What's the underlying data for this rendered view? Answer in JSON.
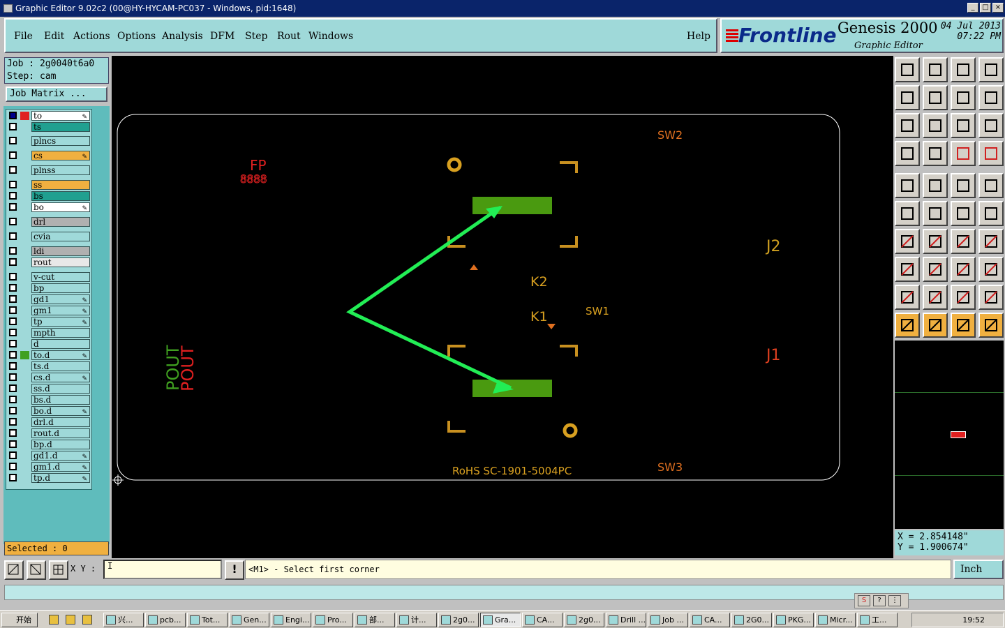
{
  "window": {
    "title": "Graphic Editor 9.02c2 (00@HY-HYCAM-PC037 - Windows, pid:1648)",
    "min": "_",
    "max": "□",
    "close": "×"
  },
  "menu": [
    "File",
    "Edit",
    "Actions",
    "Options",
    "Analysis",
    "DFM",
    "Step",
    "Rout",
    "Windows"
  ],
  "help": "Help",
  "brand": {
    "logo": "Frontline",
    "product": "Genesis 2000",
    "subtitle": "Graphic Editor",
    "date": "04 Jul 2013",
    "time": "07:22 PM"
  },
  "job": {
    "job_line": "Job : 2g0040t6a0",
    "step_line": "Step: cam",
    "matrix_button": "Job Matrix ..."
  },
  "layers": [
    {
      "name": "to",
      "color": "#ffffff",
      "pen": true
    },
    {
      "name": "ts",
      "color": "#20a090",
      "pen": false
    },
    {
      "name": "plncs",
      "color": "#9fd9d9",
      "pen": false
    },
    {
      "name": "cs",
      "color": "#f0b040",
      "pen": true
    },
    {
      "name": "plnss",
      "color": "#9fd9d9",
      "pen": false
    },
    {
      "name": "ss",
      "color": "#f0b040",
      "pen": false
    },
    {
      "name": "bs",
      "color": "#20a090",
      "pen": false
    },
    {
      "name": "bo",
      "color": "#ffffff",
      "pen": true
    },
    {
      "name": "drl",
      "color": "#b0b0b0",
      "pen": false
    },
    {
      "name": "cvia",
      "color": "#9fd9d9",
      "pen": false
    },
    {
      "name": "ldi",
      "color": "#b0b0b0",
      "pen": false
    },
    {
      "name": "rout",
      "color": "#e8e8e8",
      "pen": false
    },
    {
      "name": "v-cut",
      "color": "#9fd9d9",
      "pen": false
    },
    {
      "name": "bp",
      "color": "#9fd9d9",
      "pen": false
    },
    {
      "name": "gd1",
      "color": "#9fd9d9",
      "pen": true
    },
    {
      "name": "gm1",
      "color": "#9fd9d9",
      "pen": true
    },
    {
      "name": "tp",
      "color": "#9fd9d9",
      "pen": true
    },
    {
      "name": "mpth",
      "color": "#9fd9d9",
      "pen": false
    },
    {
      "name": "d",
      "color": "#9fd9d9",
      "pen": false
    },
    {
      "name": "to.d",
      "color": "#9fd9d9",
      "pen": true
    },
    {
      "name": "ts.d",
      "color": "#9fd9d9",
      "pen": false
    },
    {
      "name": "cs.d",
      "color": "#9fd9d9",
      "pen": true
    },
    {
      "name": "ss.d",
      "color": "#9fd9d9",
      "pen": false
    },
    {
      "name": "bs.d",
      "color": "#9fd9d9",
      "pen": false
    },
    {
      "name": "bo.d",
      "color": "#9fd9d9",
      "pen": true
    },
    {
      "name": "drl.d",
      "color": "#9fd9d9",
      "pen": false
    },
    {
      "name": "rout.d",
      "color": "#9fd9d9",
      "pen": false
    },
    {
      "name": "bp.d",
      "color": "#9fd9d9",
      "pen": false
    },
    {
      "name": "gd1.d",
      "color": "#9fd9d9",
      "pen": true
    },
    {
      "name": "gm1.d",
      "color": "#9fd9d9",
      "pen": true
    },
    {
      "name": "tp.d",
      "color": "#9fd9d9",
      "pen": true
    }
  ],
  "selected": "Selected : 0",
  "canvas_labels": {
    "fp": "FP",
    "fp_sub": "8888",
    "sw2": "SW2",
    "j2": "J2",
    "k2": "K2",
    "k1": "K1",
    "sw1": "SW1",
    "j1": "J1",
    "pout1": "POUT",
    "pout2": "POUT",
    "sw3": "SW3",
    "rohs": "RoHS SC-1901-5004PC"
  },
  "coords": {
    "x": "X = 2.854148\"",
    "y": "Y = 1.900674\""
  },
  "bottom": {
    "xy_label": "X Y :",
    "xy_value": "I",
    "prompt": "<M1> - Select first corner",
    "unit": "Inch",
    "bang": "!"
  },
  "ime": [
    "S",
    "?",
    "⋮"
  ],
  "taskbar": {
    "start": "开始",
    "tasks": [
      "兴...",
      "pcb...",
      "Tot...",
      "Gen...",
      "Engi...",
      "Pro...",
      "部...",
      "计...",
      "2g0...",
      "Gra...",
      "CA...",
      "2g0...",
      "Drill ...",
      "Job ...",
      "CA...",
      "2G0...",
      "PKG...",
      "Micr...",
      "工..."
    ],
    "clock": "19:52"
  },
  "colors": {
    "accent_panel": "#9fd9d9",
    "selected_orange": "#f0b040",
    "pad_green": "#4a9a10",
    "arrow_green": "#22ee55",
    "silk_orange": "#e0a020"
  }
}
